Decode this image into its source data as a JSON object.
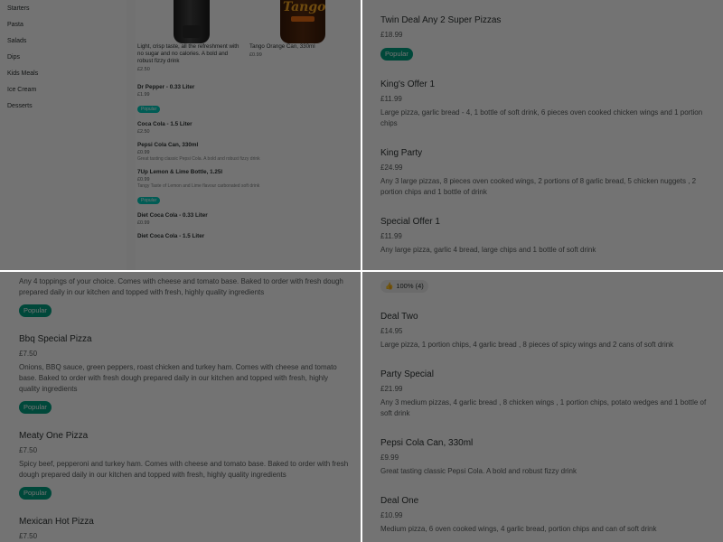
{
  "sidebar": {
    "items": [
      "Starters",
      "Pasta",
      "Salads",
      "Dips",
      "Kids Meals",
      "Ice Cream",
      "Desserts"
    ]
  },
  "drinks": {
    "featured": [
      {
        "desc": "Light, crisp taste, all the refreshment with no sugar and no calories. A bold and robust fizzy drink",
        "price": "£2.50"
      },
      {
        "desc": "Tango Orange Can, 330ml",
        "price": "£0.99"
      }
    ],
    "tango_label": "Tango",
    "items": [
      {
        "name": "Dr Pepper - 0.33 Liter",
        "price": "£1.99",
        "desc": "",
        "badge": "Popular"
      },
      {
        "name": "Coca Cola - 1.5 Liter",
        "price": "£2.50",
        "desc": "",
        "badge": ""
      },
      {
        "name": "Pepsi Cola Can, 330ml",
        "price": "£0.99",
        "desc": "Great tasting classic Pepsi Cola. A bold and robust fizzy drink",
        "badge": ""
      },
      {
        "name": "7Up Lemon & Lime Bottle, 1.25l",
        "price": "£0.99",
        "desc": "Tangy Taste of Lemon and Lime flavour carbonated soft drink",
        "badge": "Popular"
      },
      {
        "name": "Diet Coca Cola - 0.33 Liter",
        "price": "£0.99",
        "desc": "",
        "badge": ""
      },
      {
        "name": "Diet Coca Cola - 1.5 Liter",
        "price": "",
        "desc": "",
        "badge": ""
      }
    ]
  },
  "deals_top": [
    {
      "title": "Twin Deal Any 2 Super Pizzas",
      "price": "£18.99",
      "desc": "",
      "badge": "Popular"
    },
    {
      "title": "King's Offer 1",
      "price": "£11.99",
      "desc": "Large pizza, garlic bread - 4, 1 bottle of soft drink, 6 pieces oven cooked chicken wings and 1 portion chips",
      "badge": ""
    },
    {
      "title": "King Party",
      "price": "£24.99",
      "desc": "Any 3 large pizzas, 8 pieces oven cooked wings, 2 portions of 8 garlic bread, 5 chicken nuggets , 2 portion chips and 1 bottle of drink",
      "badge": ""
    },
    {
      "title": "Special Offer 1",
      "price": "£11.99",
      "desc": "Any large pizza, garlic 4 bread, large chips and 1 bottle of soft drink",
      "badge": ""
    },
    {
      "title": "Pepsi Cola Can, 330ml",
      "price": "",
      "desc": "",
      "badge": ""
    }
  ],
  "pizzas": {
    "lead_desc": "Any 4 toppings of your choice. Comes with cheese and tomato base. Baked to order with fresh dough prepared daily in our kitchen and topped with fresh, highly quality ingredients",
    "lead_badge": "Popular",
    "items": [
      {
        "title": "Bbq Special Pizza",
        "price": "£7.50",
        "desc": "Onions, BBQ sauce, green peppers, roast chicken and turkey ham. Comes with cheese and tomato base. Baked to order with fresh dough prepared daily in our kitchen and topped with fresh, highly quality ingredients",
        "badge": "Popular"
      },
      {
        "title": "Meaty One Pizza",
        "price": "£7.50",
        "desc": "Spicy beef, pepperoni and turkey ham. Comes with cheese and tomato base. Baked to order with fresh dough prepared daily in our kitchen and topped with fresh, highly quality ingredients",
        "badge": "Popular"
      },
      {
        "title": "Mexican Hot Pizza",
        "price": "£7.50",
        "desc": "",
        "badge": ""
      }
    ]
  },
  "deals_bottom": {
    "rating": "100% (4)",
    "items": [
      {
        "title": "Deal Two",
        "price": "£14.95",
        "desc": "Large pizza, 1 portion chips, 4 garlic bread , 8 pieces of spicy wings and 2 cans of soft drink"
      },
      {
        "title": "Party Special",
        "price": "£21.99",
        "desc": "Any 3 medium pizzas, 4 garlic bread , 8 chicken wings , 1 portion chips, potato wedges and 1 bottle of soft drink"
      },
      {
        "title": "Pepsi Cola Can, 330ml",
        "price": "£9.99",
        "desc": "Great tasting classic Pepsi Cola. A bold and robust fizzy drink"
      },
      {
        "title": "Deal One",
        "price": "£10.99",
        "desc": "Medium pizza, 6 oven cooked wings, 4 garlic bread, portion chips and can of soft drink"
      }
    ]
  },
  "colors": {
    "accent": "#00a082",
    "text": "#2e3333",
    "muted": "#585c5c"
  }
}
